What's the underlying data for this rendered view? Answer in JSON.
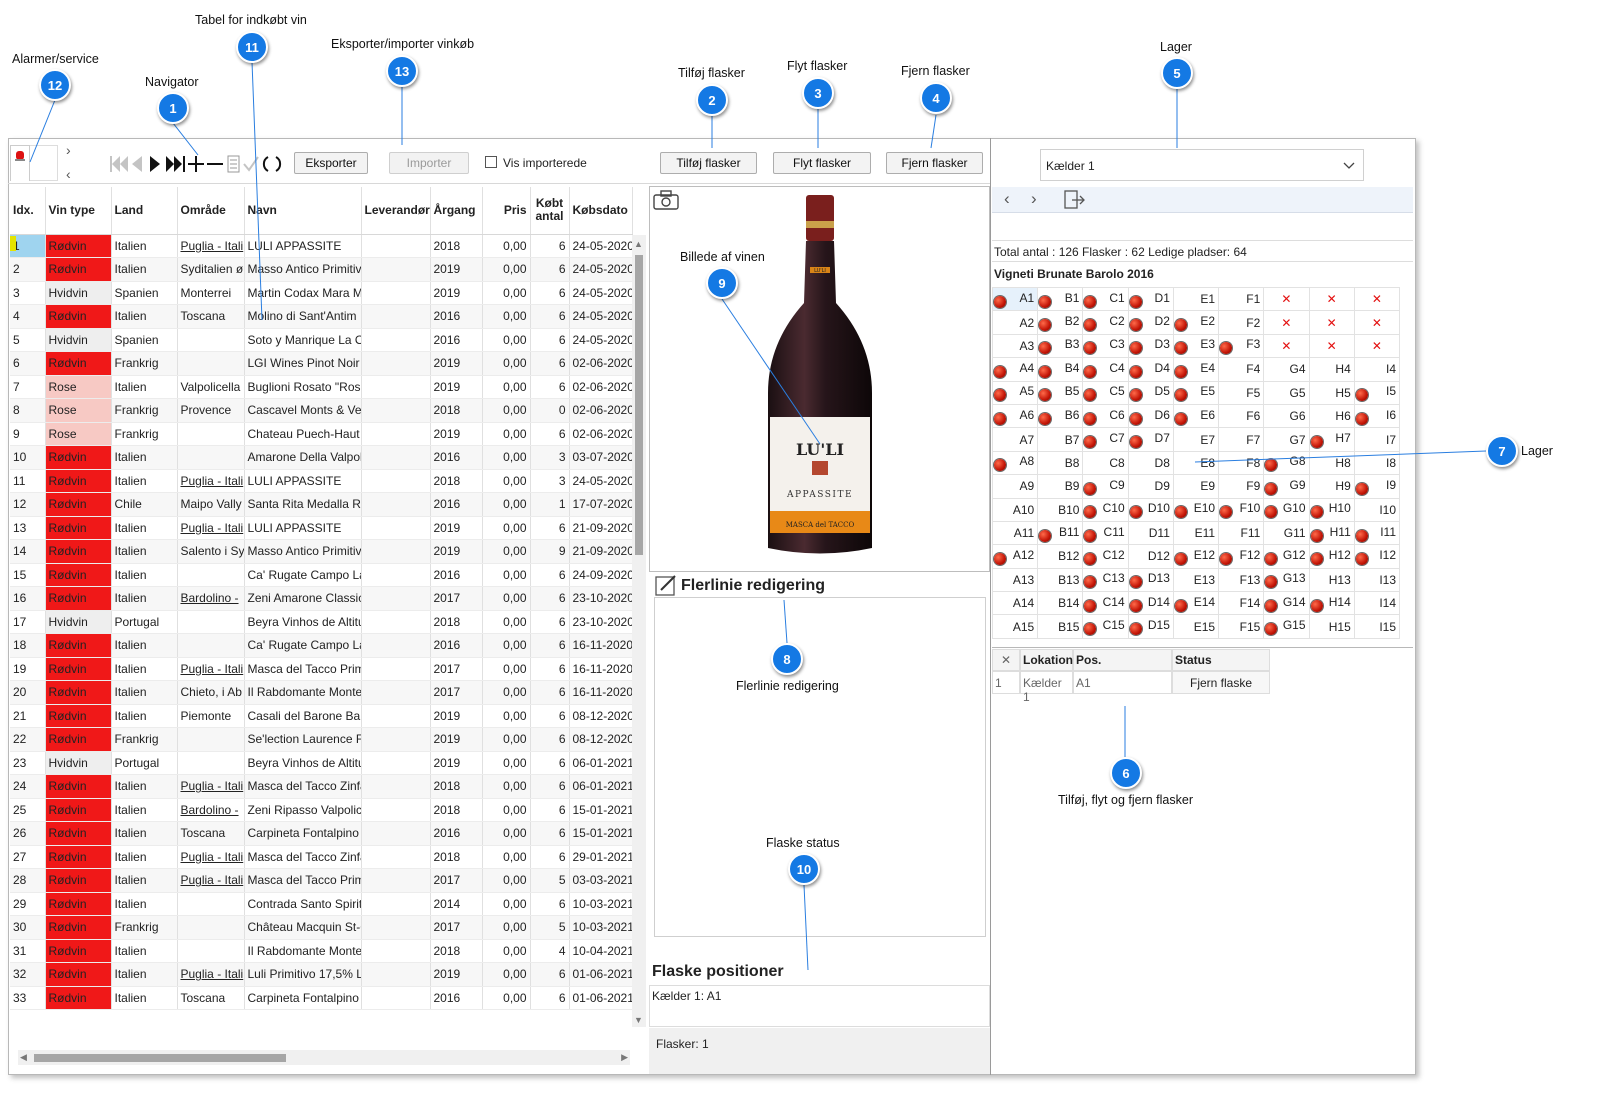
{
  "annotations": {
    "a12": {
      "num": "12",
      "label": "Alarmer/service"
    },
    "a1": {
      "num": "1",
      "label": "Navigator"
    },
    "a11": {
      "num": "11",
      "label": "Tabel for indkøbt vin"
    },
    "a13": {
      "num": "13",
      "label": "Eksporter/importer vinkøb"
    },
    "a2": {
      "num": "2",
      "label": "Tilføj flasker"
    },
    "a3": {
      "num": "3",
      "label": "Flyt flasker"
    },
    "a4": {
      "num": "4",
      "label": "Fjern flasker"
    },
    "a5": {
      "num": "5",
      "label": "Lager"
    },
    "a9": {
      "num": "9",
      "label": "Billede af vinen"
    },
    "a7": {
      "num": "7",
      "label": "Lager"
    },
    "a8": {
      "num": "8",
      "label": "Flerlinie redigering"
    },
    "a6": {
      "num": "6",
      "label": "Tilføj, flyt og fjern flasker"
    },
    "a10": {
      "num": "10",
      "label": "Flaske status"
    }
  },
  "toolbar": {
    "export": "Eksporter",
    "import": "Importer",
    "show_imported": "Vis importerede",
    "add": "Tilføj flasker",
    "move": "Flyt flasker",
    "remove": "Fjern flasker"
  },
  "storage": {
    "selected": "Kælder 1",
    "summary": "Total antal : 126  Flasker : 62  Ledige pladser: 64",
    "wine": "Vigneti Brunate Barolo 2016"
  },
  "columns": [
    "Idx.",
    "Vin type",
    "Land",
    "Område",
    "Navn",
    "Leverandør",
    "Årgang",
    "Pris",
    "Købt antal",
    "Købsdato"
  ],
  "rows": [
    [
      "1",
      "Rødvin",
      "Italien",
      "Puglia - Itali",
      "LULI APPASSITE",
      "",
      "2018",
      "0,00",
      "6",
      "24-05-2020"
    ],
    [
      "2",
      "Rødvin",
      "Italien",
      "Syditalien ø",
      "Masso Antico Primitiv",
      "",
      "2019",
      "0,00",
      "6",
      "24-05-2020"
    ],
    [
      "3",
      "Hvidvin",
      "Spanien",
      "Monterrei",
      "Martin Codax Mara M",
      "",
      "2019",
      "0,00",
      "6",
      "24-05-2020"
    ],
    [
      "4",
      "Rødvin",
      "Italien",
      "Toscana",
      "Molino di Sant'Antim",
      "",
      "2016",
      "0,00",
      "6",
      "24-05-2020"
    ],
    [
      "5",
      "Hvidvin",
      "Spanien",
      "",
      "Soto y Manrique La O",
      "",
      "2016",
      "0,00",
      "6",
      "24-05-2020"
    ],
    [
      "6",
      "Rødvin",
      "Frankrig",
      "",
      "LGI Wines Pinot Noir",
      "",
      "2019",
      "0,00",
      "6",
      "02-06-2020"
    ],
    [
      "7",
      "Rose",
      "Italien",
      "Valpolicella",
      "Buglioni Rosato \"Rosa",
      "",
      "2019",
      "0,00",
      "6",
      "02-06-2020"
    ],
    [
      "8",
      "Rose",
      "Frankrig",
      "Provence",
      "Cascavel Monts & Ver",
      "",
      "2018",
      "0,00",
      "0",
      "02-06-2020"
    ],
    [
      "9",
      "Rose",
      "Frankrig",
      "",
      "Chateau Puech-Haut",
      "",
      "2019",
      "0,00",
      "6",
      "02-06-2020"
    ],
    [
      "10",
      "Rødvin",
      "Italien",
      "",
      "Amarone Della Valpol",
      "",
      "2016",
      "0,00",
      "3",
      "03-07-2020"
    ],
    [
      "11",
      "Rødvin",
      "Italien",
      "Puglia - Itali",
      "LULI APPASSITE",
      "",
      "2018",
      "0,00",
      "3",
      "24-05-2020"
    ],
    [
      "12",
      "Rødvin",
      "Chile",
      "Maipo Vally",
      "Santa Rita Medalla Re",
      "",
      "2016",
      "0,00",
      "1",
      "17-07-2020"
    ],
    [
      "13",
      "Rødvin",
      "Italien",
      "Puglia - Itali",
      "LULI APPASSITE",
      "",
      "2019",
      "0,00",
      "6",
      "21-09-2020"
    ],
    [
      "14",
      "Rødvin",
      "Italien",
      "Salento i Sy",
      "Masso Antico Primitiv",
      "",
      "2019",
      "0,00",
      "9",
      "21-09-2020"
    ],
    [
      "15",
      "Rødvin",
      "Italien",
      "",
      "Ca' Rugate Campo La",
      "",
      "2016",
      "0,00",
      "6",
      "24-09-2020"
    ],
    [
      "16",
      "Rødvin",
      "Italien",
      "Bardolino -",
      "Zeni Amarone Classic",
      "",
      "2017",
      "0,00",
      "6",
      "23-10-2020"
    ],
    [
      "17",
      "Hvidvin",
      "Portugal",
      "",
      "Beyra Vinhos de Altitu",
      "",
      "2018",
      "0,00",
      "6",
      "23-10-2020"
    ],
    [
      "18",
      "Rødvin",
      "Italien",
      "",
      "Ca' Rugate Campo La",
      "",
      "2016",
      "0,00",
      "6",
      "16-11-2020"
    ],
    [
      "19",
      "Rødvin",
      "Italien",
      "Puglia - Itali",
      "Masca del Tacco Prim",
      "",
      "2017",
      "0,00",
      "6",
      "16-11-2020"
    ],
    [
      "20",
      "Rødvin",
      "Italien",
      "Chieto, i Ab",
      "Il Rabdomante Monte",
      "",
      "2017",
      "0,00",
      "6",
      "16-11-2020"
    ],
    [
      "21",
      "Rødvin",
      "Italien",
      "Piemonte",
      "Casali del Barone Barl",
      "",
      "2019",
      "0,00",
      "6",
      "08-12-2020"
    ],
    [
      "22",
      "Rødvin",
      "Frankrig",
      "",
      "Se'lection Laurence Fe",
      "",
      "2019",
      "0,00",
      "6",
      "08-12-2020"
    ],
    [
      "23",
      "Hvidvin",
      "Portugal",
      "",
      "Beyra Vinhos de Altitu",
      "",
      "2019",
      "0,00",
      "6",
      "06-01-2021"
    ],
    [
      "24",
      "Rødvin",
      "Italien",
      "Puglia - Itali",
      "Masca del Tacco Zinfa",
      "",
      "2018",
      "0,00",
      "6",
      "06-01-2021"
    ],
    [
      "25",
      "Rødvin",
      "Italien",
      "Bardolino -",
      "Zeni Ripasso Valpolice",
      "",
      "2018",
      "0,00",
      "6",
      "15-01-2021"
    ],
    [
      "26",
      "Rødvin",
      "Italien",
      "Toscana",
      "Carpineta Fontalpino",
      "",
      "2016",
      "0,00",
      "6",
      "15-01-2021"
    ],
    [
      "27",
      "Rødvin",
      "Italien",
      "Puglia - Itali",
      "Masca del Tacco Zinfa",
      "",
      "2018",
      "0,00",
      "6",
      "29-01-2021"
    ],
    [
      "28",
      "Rødvin",
      "Italien",
      "Puglia - Itali",
      "Masca del Tacco Prim",
      "",
      "2017",
      "0,00",
      "5",
      "03-03-2021"
    ],
    [
      "29",
      "Rødvin",
      "Italien",
      "",
      "Contrada Santo Spirit",
      "",
      "2014",
      "0,00",
      "6",
      "10-03-2021"
    ],
    [
      "30",
      "Rødvin",
      "Frankrig",
      "",
      "Château Macquin St-C",
      "",
      "2017",
      "0,00",
      "5",
      "10-03-2021"
    ],
    [
      "31",
      "Rødvin",
      "Italien",
      "",
      "Il Rabdomante Monte",
      "",
      "2018",
      "0,00",
      "4",
      "10-04-2021"
    ],
    [
      "32",
      "Rødvin",
      "Italien",
      "Puglia - Itali",
      "Luli Primitivo 17,5% Li",
      "",
      "2019",
      "0,00",
      "6",
      "01-06-2021"
    ],
    [
      "33",
      "Rødvin",
      "Italien",
      "Toscana",
      "Carpineta Fontalpino",
      "",
      "2016",
      "0,00",
      "6",
      "01-06-2021"
    ]
  ],
  "bottle": {
    "brand": "LU'LI",
    "name": "APPASSITE",
    "maker": "MASCA del TACCO",
    "top": "LU'LI"
  },
  "multiline": {
    "title": "Flerlinie redigering"
  },
  "positions": {
    "title": "Flaske positioner",
    "text": "Kælder 1: A1",
    "count": "Flasker: 1"
  },
  "grid_rows": [
    [
      "A1*",
      "B1*",
      "C1*",
      "D1*",
      "E1",
      "F1",
      "x",
      "x",
      "x"
    ],
    [
      "A2",
      "B2*",
      "C2*",
      "D2*",
      "E2*",
      "F2",
      "x",
      "x",
      "x"
    ],
    [
      "A3",
      "B3*",
      "C3*",
      "D3*",
      "E3*",
      "F3*",
      "x",
      "x",
      "x"
    ],
    [
      "A4*",
      "B4*",
      "C4*",
      "D4*",
      "E4*",
      "F4",
      "G4",
      "H4",
      "I4"
    ],
    [
      "A5*",
      "B5*",
      "C5*",
      "D5*",
      "E5*",
      "F5",
      "G5",
      "H5",
      "I5*"
    ],
    [
      "A6*",
      "B6*",
      "C6*",
      "D6*",
      "E6*",
      "F6",
      "G6",
      "H6",
      "I6*"
    ],
    [
      "A7",
      "B7",
      "C7*",
      "D7*",
      "E7",
      "F7",
      "G7",
      "H7*",
      "I7"
    ],
    [
      "A8*",
      "B8",
      "C8",
      "D8",
      "E8",
      "F8",
      "G8*",
      "H8",
      "I8"
    ],
    [
      "A9",
      "B9",
      "C9*",
      "D9",
      "E9",
      "F9",
      "G9*",
      "H9",
      "I9*"
    ],
    [
      "A10",
      "B10",
      "C10*",
      "D10*",
      "E10*",
      "F10*",
      "G10*",
      "H10*",
      "I10"
    ],
    [
      "A11",
      "B11*",
      "C11*",
      "D11",
      "E11",
      "F11",
      "G11",
      "H11*",
      "I11*"
    ],
    [
      "A12*",
      "B12",
      "C12*",
      "D12",
      "E12*",
      "F12*",
      "G12*",
      "H12*",
      "I12*"
    ],
    [
      "A13",
      "B13",
      "C13*",
      "D13*",
      "E13",
      "F13",
      "G13*",
      "H13",
      "I13"
    ],
    [
      "A14",
      "B14",
      "C14*",
      "D14*",
      "E14*",
      "F14",
      "G14*",
      "H14*",
      "I14"
    ],
    [
      "A15",
      "B15",
      "C15*",
      "D15*",
      "E15",
      "F15",
      "G15*",
      "H15",
      "I15"
    ]
  ],
  "status_table": {
    "headers": [
      "Lokation",
      "Pos.",
      "Status"
    ],
    "row": {
      "idx": "1",
      "loc": "Kælder 1",
      "pos": "A1",
      "status": "Fjern flaske"
    }
  },
  "colors": {
    "red_wine": "#f01818",
    "rose": "#f7c9c4",
    "white": "#eeeeee",
    "pin": "#1479e4"
  },
  "icons": [
    "bell-alarm-icon",
    "first-icon",
    "prev-icon",
    "play-icon",
    "last-icon",
    "add-icon",
    "delete-icon",
    "edit-icon",
    "check-icon",
    "refresh-icon",
    "camera-icon",
    "pencil-icon",
    "exit-icon",
    "dropdown-icon"
  ]
}
